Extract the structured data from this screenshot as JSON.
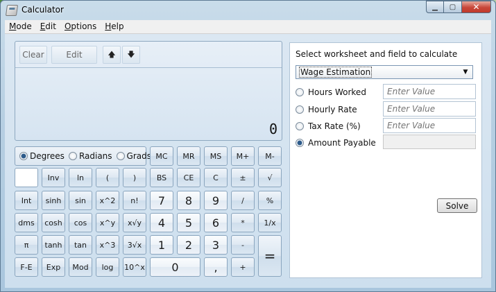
{
  "window": {
    "title": "Calculator"
  },
  "menu": [
    {
      "label": "Mode",
      "underline": "M",
      "rest": "ode"
    },
    {
      "label": "Edit",
      "underline": "E",
      "rest": "dit"
    },
    {
      "label": "Options",
      "underline": "O",
      "rest": "ptions"
    },
    {
      "label": "Help",
      "underline": "H",
      "rest": "elp"
    }
  ],
  "display": {
    "clear_label": "Clear",
    "edit_label": "Edit",
    "up_glyph": "🡅",
    "down_glyph": "🡇",
    "value": "0"
  },
  "angle": {
    "options": [
      "Degrees",
      "Radians",
      "Grads"
    ],
    "selected": "Degrees"
  },
  "memory": [
    "MC",
    "MR",
    "MS",
    "M+",
    "M-"
  ],
  "keys": {
    "row1": [
      "",
      "Inv",
      "ln",
      "(",
      ")",
      "BS",
      "CE",
      "C",
      "±",
      "√"
    ],
    "row2": [
      "Int",
      "sinh",
      "sin",
      "x^2",
      "n!",
      "7",
      "8",
      "9",
      "/",
      "%"
    ],
    "row3": [
      "dms",
      "cosh",
      "cos",
      "x^y",
      "x√y",
      "4",
      "5",
      "6",
      "*",
      "1/x"
    ],
    "row4": [
      "π",
      "tanh",
      "tan",
      "x^3",
      "3√x",
      "1",
      "2",
      "3",
      "-"
    ],
    "row5": [
      "F-E",
      "Exp",
      "Mod",
      "log",
      "10^x",
      "0",
      ",",
      "+"
    ],
    "equals": "="
  },
  "worksheet": {
    "title": "Select worksheet and field to calculate",
    "selected": "Wage Estimation",
    "fields": [
      {
        "label": "Hours Worked",
        "placeholder": "Enter Value",
        "selected": false
      },
      {
        "label": "Hourly Rate",
        "placeholder": "Enter Value",
        "selected": false
      },
      {
        "label": "Tax Rate (%)",
        "placeholder": "Enter Value",
        "selected": false
      },
      {
        "label": "Amount Payable",
        "placeholder": "",
        "selected": true
      }
    ],
    "solve_label": "Solve"
  }
}
